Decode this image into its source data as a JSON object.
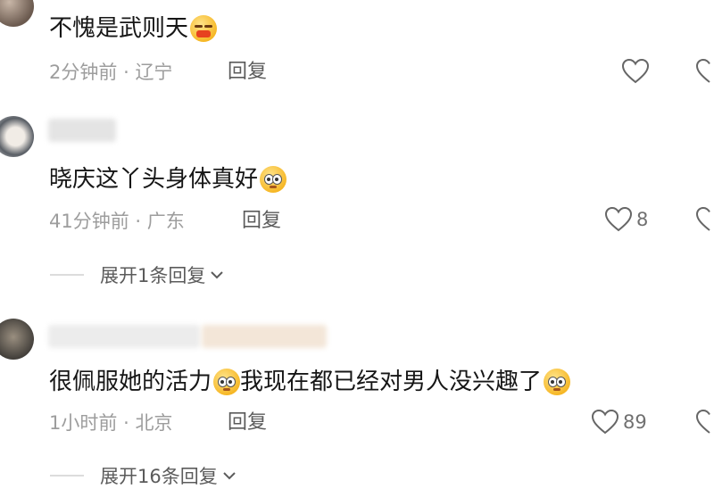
{
  "comments": [
    {
      "text": "不愧是武则天",
      "emoji": [
        "wave-emoji"
      ],
      "time": "2分钟前",
      "location": "辽宁",
      "reply_label": "回复",
      "likes": ""
    },
    {
      "text": "晓庆这丫头身体真好",
      "emoji": [
        "pleading-emoji"
      ],
      "time": "41分钟前",
      "location": "广东",
      "reply_label": "回复",
      "likes": "8",
      "expand_label": "展开1条回复"
    },
    {
      "text_part1": "很佩服她的活力",
      "text_part2": "我现在都已经对男人没兴趣了",
      "emoji": [
        "pleading-emoji",
        "pleading-emoji"
      ],
      "time": "1小时前",
      "location": "北京",
      "reply_label": "回复",
      "likes": "89",
      "expand_label": "展开16条回复"
    }
  ],
  "separator": "·",
  "colors": {
    "text": "#161616",
    "meta": "#9d9d9d",
    "action": "#5b5b5b"
  }
}
